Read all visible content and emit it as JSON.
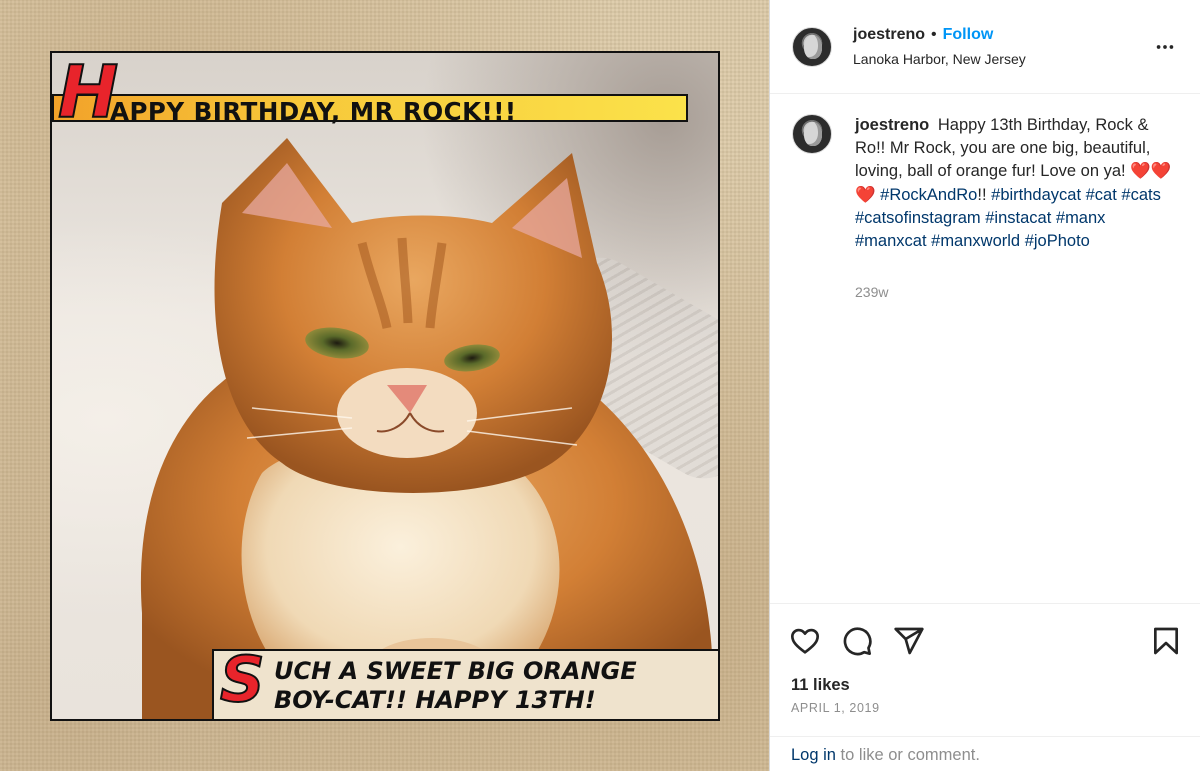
{
  "post_image": {
    "top_caption_initial": "H",
    "top_caption_rest": "APPY BIRTHDAY, MR ROCK!!!",
    "bottom_caption_initial": "S",
    "bottom_caption_line1": "UCH A SWEET BIG ORANGE",
    "bottom_caption_line2": "BOY-CAT!! HAPPY 13TH!"
  },
  "header": {
    "username": "joestreno",
    "separator": "•",
    "follow_label": "Follow",
    "location": "Lanoka Harbor, New Jersey",
    "more_icon": "more-horizontal-icon"
  },
  "caption": {
    "username": "joestreno",
    "text_part1": "Happy 13th Birthday, Rock & Ro!! Mr Rock, you are one big, beautiful, loving, ball of orange fur! Love on ya!",
    "hearts": "❤️❤️❤️",
    "hashtag_1": "#RockAndRo",
    "text_part2": "!!",
    "hashtag_2": "#birthdaycat",
    "hashtag_3": "#cat",
    "hashtag_4": "#cats",
    "hashtag_5": "#catsofinstagram",
    "hashtag_6": "#instacat",
    "hashtag_7": "#manx",
    "hashtag_8": "#manxcat",
    "hashtag_9": "#manxworld",
    "hashtag_10": "#joPhoto",
    "time_ago": "239w"
  },
  "actions": {
    "like_icon": "heart-icon",
    "comment_icon": "comment-icon",
    "share_icon": "share-icon",
    "save_icon": "bookmark-icon",
    "likes": "11 likes",
    "date": "APRIL 1, 2019",
    "login_link": "Log in",
    "login_rest": " to like or comment."
  },
  "colors": {
    "link_blue": "#0095f6",
    "hashtag": "#00376b",
    "muted": "#8e8e8e",
    "text": "#262626"
  }
}
